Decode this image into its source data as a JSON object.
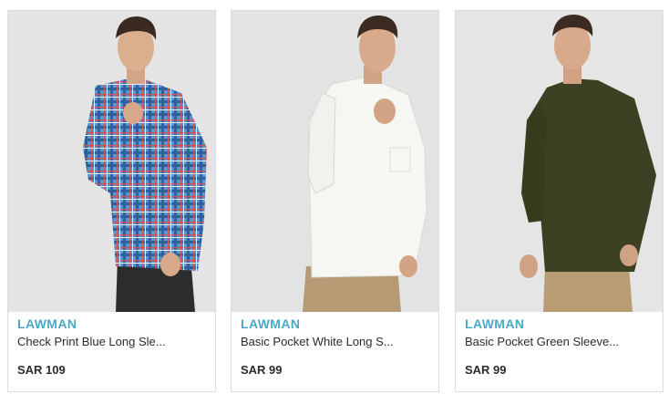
{
  "products": [
    {
      "brand": "LAWMAN",
      "title": "Check Print Blue Long Sle...",
      "price": "SAR 109",
      "image_icon": "model-shirt-photo",
      "shirt_color": "#4a86c4"
    },
    {
      "brand": "LAWMAN",
      "title": "Basic Pocket White Long S...",
      "price": "SAR 99",
      "image_icon": "model-shirt-photo",
      "shirt_color": "#f4f4f2"
    },
    {
      "brand": "LAWMAN",
      "title": "Basic Pocket Green Sleeve...",
      "price": "SAR 99",
      "image_icon": "model-shirt-photo",
      "shirt_color": "#3f4224"
    }
  ],
  "colors": {
    "brand": "#4aa8c4",
    "text": "#2b2b2b",
    "border": "#dcdcdc",
    "photo_bg": "#e6e6e6"
  }
}
